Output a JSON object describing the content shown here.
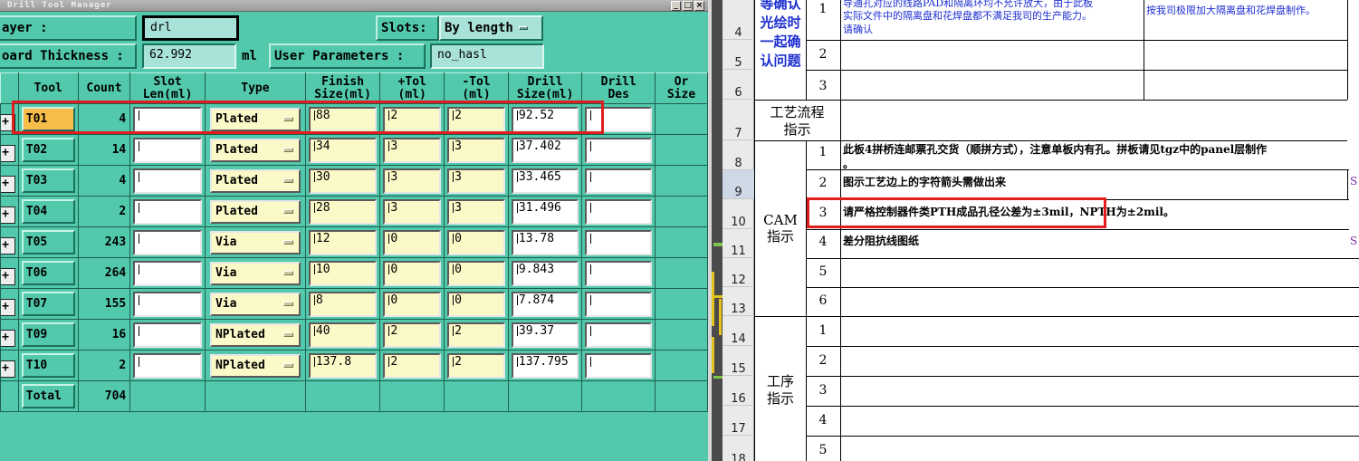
{
  "drill_manager": {
    "title": "Drill Tool Manager",
    "layer_label": "ayer        :",
    "layer_value": "drl",
    "slots_label": "Slots:",
    "slots_value": "By length",
    "thickness_label": "oard Thickness :",
    "thickness_value": "62.992",
    "thickness_unit": "ml",
    "user_params_label": "User Parameters :",
    "user_params_value": "no_hasl",
    "columns": [
      "Tool",
      "Count",
      "Slot\nLen(ml)",
      "Type",
      "Finish\nSize(ml)",
      "+Tol\n(ml)",
      "-Tol\n(ml)",
      "Drill\nSize(ml)",
      "Drill\nDes",
      "Or\nSize"
    ],
    "rows": [
      {
        "tool": "T01",
        "count": "4",
        "type": "Plated",
        "finish": "88",
        "ptol": "2",
        "ntol": "2",
        "drill": "92.52"
      },
      {
        "tool": "T02",
        "count": "14",
        "type": "Plated",
        "finish": "34",
        "ptol": "3",
        "ntol": "3",
        "drill": "37.402"
      },
      {
        "tool": "T03",
        "count": "4",
        "type": "Plated",
        "finish": "30",
        "ptol": "3",
        "ntol": "3",
        "drill": "33.465"
      },
      {
        "tool": "T04",
        "count": "2",
        "type": "Plated",
        "finish": "28",
        "ptol": "3",
        "ntol": "3",
        "drill": "31.496"
      },
      {
        "tool": "T05",
        "count": "243",
        "type": "Via",
        "finish": "12",
        "ptol": "0",
        "ntol": "0",
        "drill": "13.78"
      },
      {
        "tool": "T06",
        "count": "264",
        "type": "Via",
        "finish": "10",
        "ptol": "0",
        "ntol": "0",
        "drill": "9.843"
      },
      {
        "tool": "T07",
        "count": "155",
        "type": "Via",
        "finish": "8",
        "ptol": "0",
        "ntol": "0",
        "drill": "7.874"
      },
      {
        "tool": "T09",
        "count": "16",
        "type": "NPlated",
        "finish": "40",
        "ptol": "2",
        "ntol": "2",
        "drill": "39.37"
      },
      {
        "tool": "T10",
        "count": "2",
        "type": "NPlated",
        "finish": "137.8",
        "ptol": "2",
        "ntol": "2",
        "drill": "137.795"
      }
    ],
    "total_label": "Total",
    "total_count": "704",
    "plus_glyph": "+"
  },
  "spreadsheet": {
    "row_numbers": [
      "4",
      "5",
      "6",
      "7",
      "8",
      "9",
      "10",
      "11",
      "12",
      "13",
      "14",
      "15",
      "16",
      "17",
      "18"
    ],
    "top_section": {
      "label_lines": [
        "等确认",
        "光绘时",
        "一起确",
        "认问题"
      ],
      "items": [
        {
          "n": "1",
          "text": "导通孔对应的线路PAD和隔离环均不允许放大，由于此板",
          "text2": "实际文件中的隔离盘和花焊盘都不满足我司的生产能力。",
          "text3": "请确认",
          "reply": "按我司极限加大隔离盘和花焊盘制作。"
        },
        {
          "n": "2"
        },
        {
          "n": "3"
        }
      ]
    },
    "process_label": [
      "工艺流程",
      "指示"
    ],
    "cam_section": {
      "label_lines": [
        "CAM",
        "指示"
      ],
      "items": [
        {
          "n": "1",
          "text": "此板4拼桥连邮票孔交货（顺拼方式），注意单板内有孔。拼板请见tgz中的panel层制作",
          "text2": "。"
        },
        {
          "n": "2",
          "text": "图示工艺边上的字符箭头需做出来"
        },
        {
          "n": "3",
          "text": "请严格控制器件类PTH成品孔径公差为±3mil，NPTH为±2mil。"
        },
        {
          "n": "4",
          "text": "差分阻抗线图纸"
        },
        {
          "n": "5",
          "text": ""
        },
        {
          "n": "6",
          "text": ""
        }
      ]
    },
    "process_section": {
      "label_lines": [
        "工序",
        "指示"
      ],
      "items": [
        {
          "n": "1"
        },
        {
          "n": "2"
        },
        {
          "n": "3"
        },
        {
          "n": "4"
        },
        {
          "n": "5"
        }
      ]
    },
    "edge_marks": [
      "S",
      "S"
    ]
  },
  "colors": {
    "panel_bg": "#52c9ac",
    "highlight": "#e11d1d",
    "active_tool": "#f6bd48",
    "blue_text": "#1d2fd0"
  }
}
